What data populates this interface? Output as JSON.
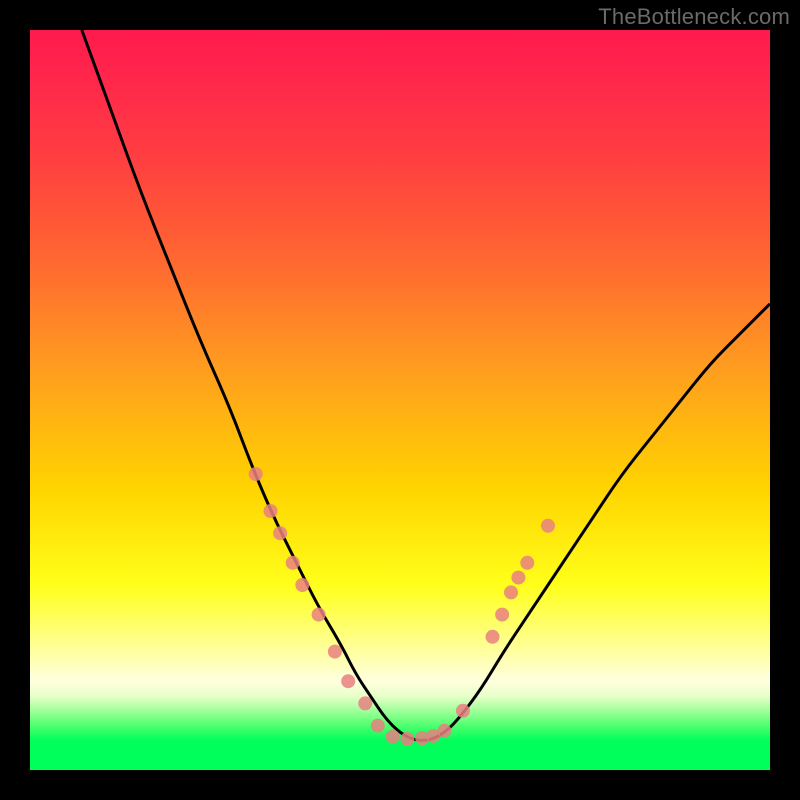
{
  "watermark": "TheBottleneck.com",
  "chart_data": {
    "type": "line",
    "title": "",
    "xlabel": "",
    "ylabel": "",
    "xlim": [
      0,
      100
    ],
    "ylim": [
      0,
      100
    ],
    "grid": false,
    "legend": false,
    "series": [
      {
        "name": "bottleneck-curve",
        "color": "#000000",
        "x": [
          7,
          11,
          15,
          19,
          23,
          27,
          30,
          33,
          36,
          39,
          42,
          44,
          46,
          48,
          50,
          52,
          54,
          56,
          58,
          61,
          64,
          68,
          72,
          76,
          80,
          84,
          88,
          92,
          96,
          100
        ],
        "y": [
          100,
          89,
          78,
          68,
          58,
          49,
          41,
          34,
          28,
          22,
          17,
          13,
          10,
          7,
          5,
          4,
          4,
          5,
          7,
          11,
          16,
          22,
          28,
          34,
          40,
          45,
          50,
          55,
          59,
          63
        ]
      }
    ],
    "markers": [
      {
        "name": "sample-points",
        "color": "#e98080",
        "radius": 7,
        "x": [
          30.5,
          32.5,
          33.8,
          35.5,
          36.8,
          39.0,
          41.2,
          43.0,
          45.3,
          47.0,
          49.0,
          51.0,
          53.0,
          54.5,
          56.0,
          58.5,
          62.5,
          63.8,
          65.0,
          66.0,
          67.2,
          70.0
        ],
        "y": [
          40,
          35,
          32,
          28,
          25,
          21,
          16,
          12,
          9,
          6,
          4.5,
          4.2,
          4.3,
          4.6,
          5.3,
          8,
          18,
          21,
          24,
          26,
          28,
          33
        ]
      }
    ],
    "annotations": []
  }
}
